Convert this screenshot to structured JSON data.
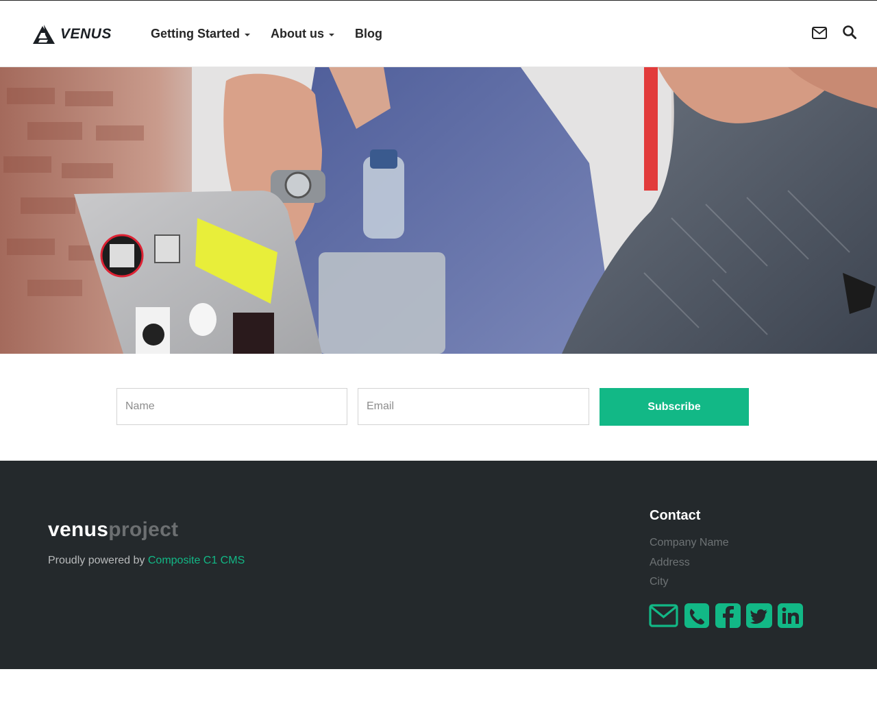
{
  "header": {
    "logo_text": "VENUS",
    "nav": [
      {
        "label": "Getting Started",
        "has_dropdown": true
      },
      {
        "label": "About us",
        "has_dropdown": true
      },
      {
        "label": "Blog",
        "has_dropdown": false
      }
    ],
    "icons": [
      "mail-icon",
      "search-icon"
    ]
  },
  "hero": {
    "image": "photo-laptop-meeting"
  },
  "subscribe": {
    "name_placeholder": "Name",
    "email_placeholder": "Email",
    "button_label": "Subscribe"
  },
  "footer": {
    "brand_part1": "venus",
    "brand_part2": "project",
    "powered_prefix": "Proudly powered by ",
    "powered_link": "Composite C1 CMS",
    "contact_title": "Contact",
    "contact_lines": [
      "Company Name",
      "Address",
      "City"
    ],
    "social_icons": [
      "mail-icon",
      "phone-icon",
      "facebook-icon",
      "twitter-icon",
      "linkedin-icon"
    ]
  },
  "colors": {
    "accent": "#12b886",
    "footer_bg": "#24292c",
    "text_dark": "#262626",
    "footer_muted": "#6e7375"
  }
}
